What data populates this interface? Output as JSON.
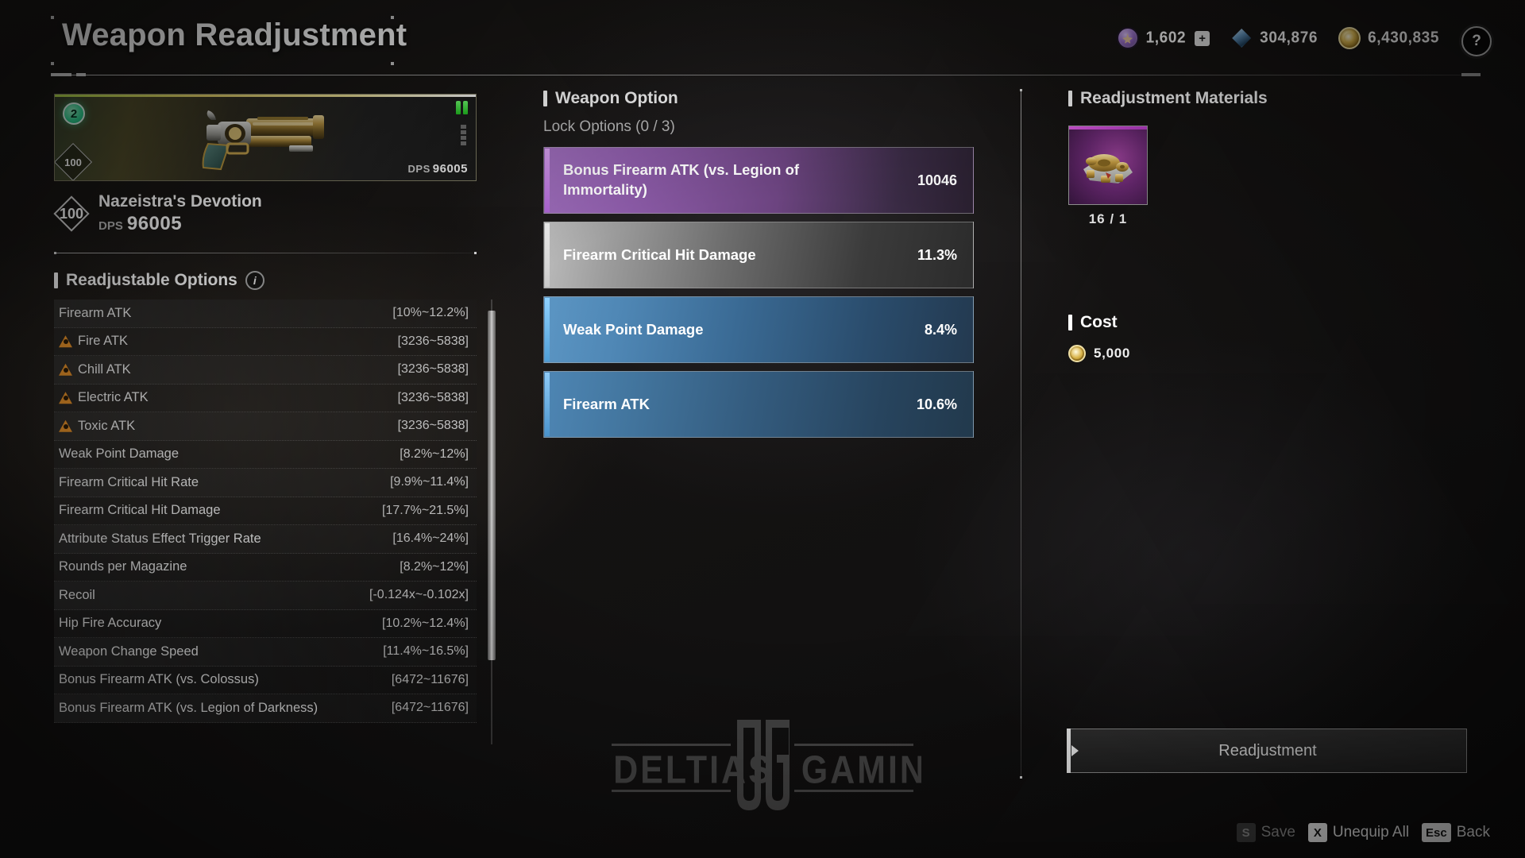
{
  "header": {
    "title": "Weapon Readjustment",
    "help_icon": "question-mark-icon",
    "currencies": [
      {
        "icon": "caliber-icon",
        "value": "1,602",
        "has_plus": true,
        "plus_label": "+"
      },
      {
        "icon": "gem-icon",
        "value": "304,876",
        "has_plus": false,
        "plus_label": ""
      },
      {
        "icon": "gold-icon",
        "value": "6,430,835",
        "has_plus": false,
        "plus_label": ""
      }
    ]
  },
  "weapon": {
    "tier_badge": "2",
    "level_badge": "100",
    "card_dps_label": "DPS",
    "card_dps_value": "96005",
    "name": "Nazeistra's Devotion",
    "dps_label": "DPS",
    "dps_value": "96005",
    "ammo_icons": 2,
    "mod_slots": 4
  },
  "readjustable": {
    "title": "Readjustable Options",
    "info_icon": "info-icon",
    "rows": [
      {
        "name": "Firearm ATK",
        "range": "[10%~12.2%]",
        "warn": false
      },
      {
        "name": "Fire ATK",
        "range": "[3236~5838]",
        "warn": true
      },
      {
        "name": "Chill ATK",
        "range": "[3236~5838]",
        "warn": true
      },
      {
        "name": "Electric ATK",
        "range": "[3236~5838]",
        "warn": true
      },
      {
        "name": "Toxic ATK",
        "range": "[3236~5838]",
        "warn": true
      },
      {
        "name": "Weak Point Damage",
        "range": "[8.2%~12%]",
        "warn": false
      },
      {
        "name": "Firearm Critical Hit Rate",
        "range": "[9.9%~11.4%]",
        "warn": false
      },
      {
        "name": "Firearm Critical Hit Damage",
        "range": "[17.7%~21.5%]",
        "warn": false
      },
      {
        "name": "Attribute Status Effect Trigger Rate",
        "range": "[16.4%~24%]",
        "warn": false
      },
      {
        "name": "Rounds per Magazine",
        "range": "[8.2%~12%]",
        "warn": false
      },
      {
        "name": "Recoil",
        "range": "[-0.124x~-0.102x]",
        "warn": false
      },
      {
        "name": "Hip Fire Accuracy",
        "range": "[10.2%~12.4%]",
        "warn": false
      },
      {
        "name": "Weapon Change Speed",
        "range": "[11.4%~16.5%]",
        "warn": false
      },
      {
        "name": "Bonus Firearm ATK (vs. Colossus)",
        "range": "[6472~11676]",
        "warn": false
      },
      {
        "name": "Bonus Firearm ATK (vs. Legion of Darkness)",
        "range": "[6472~11676]",
        "warn": false
      }
    ]
  },
  "weapon_option": {
    "title": "Weapon Option",
    "lock_label": "Lock Options (0 / 3)",
    "cards": [
      {
        "name": "Bonus Firearm ATK (vs. Legion of Immortality)",
        "value": "10046",
        "color": "purple"
      },
      {
        "name": "Firearm Critical Hit Damage",
        "value": "11.3%",
        "color": "silver"
      },
      {
        "name": "Weak Point Damage",
        "value": "8.4%",
        "color": "blue"
      },
      {
        "name": "Firearm ATK",
        "value": "10.6%",
        "color": "blue2"
      }
    ]
  },
  "materials": {
    "title": "Readjustment Materials",
    "items": [
      {
        "icon": "module-material-icon",
        "count": "16 / 1"
      }
    ]
  },
  "cost": {
    "title": "Cost",
    "icon": "gold-icon",
    "value": "5,000"
  },
  "actions": {
    "readjustment_label": "Readjustment"
  },
  "watermark": {
    "left": "DELTIAS",
    "mono": "DG",
    "right": "GAMING"
  },
  "hints": [
    {
      "key": "S",
      "label": "Save",
      "enabled": false
    },
    {
      "key": "X",
      "label": "Unequip All",
      "enabled": true
    },
    {
      "key": "Esc",
      "label": "Back",
      "enabled": true
    }
  ],
  "colors": {
    "accent_green": "#2fd694",
    "purple": "#9f6ebd",
    "blue": "#5c96c4",
    "warn_orange": "#f0972b",
    "gold": "#e8c660"
  }
}
